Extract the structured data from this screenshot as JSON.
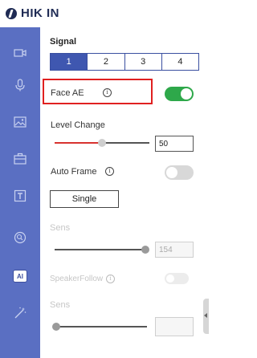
{
  "brand": {
    "name": "HIK IN"
  },
  "sidebar": {
    "items": [
      {
        "icon": "camera-icon"
      },
      {
        "icon": "microphone-icon"
      },
      {
        "icon": "image-icon"
      },
      {
        "icon": "briefcase-icon"
      },
      {
        "icon": "text-icon"
      },
      {
        "icon": "zoom-icon"
      },
      {
        "icon": "ai-icon",
        "label": "AI",
        "active": true
      },
      {
        "icon": "magic-wand-icon"
      }
    ]
  },
  "signal": {
    "title": "Signal",
    "tabs": [
      "1",
      "2",
      "3",
      "4"
    ],
    "active_tab": "1"
  },
  "face_ae": {
    "label": "Face AE",
    "info": "i",
    "enabled": true
  },
  "level_change": {
    "label": "Level Change",
    "value": "50",
    "level": 0.5
  },
  "auto_frame": {
    "label": "Auto Frame",
    "info": "i",
    "enabled": false,
    "mode_button": "Single"
  },
  "sens1": {
    "label": "Sens",
    "value": "154"
  },
  "speaker_follow": {
    "label": "SpeakerFollow",
    "info": "i",
    "enabled": false
  },
  "sens2": {
    "label": "Sens",
    "value": ""
  },
  "colors": {
    "accent": "#3f57b0",
    "sidebar": "#5a6fc2",
    "toggle_on": "#2ea84a",
    "slider_fill": "#d8322f",
    "highlight": "#e02020"
  }
}
